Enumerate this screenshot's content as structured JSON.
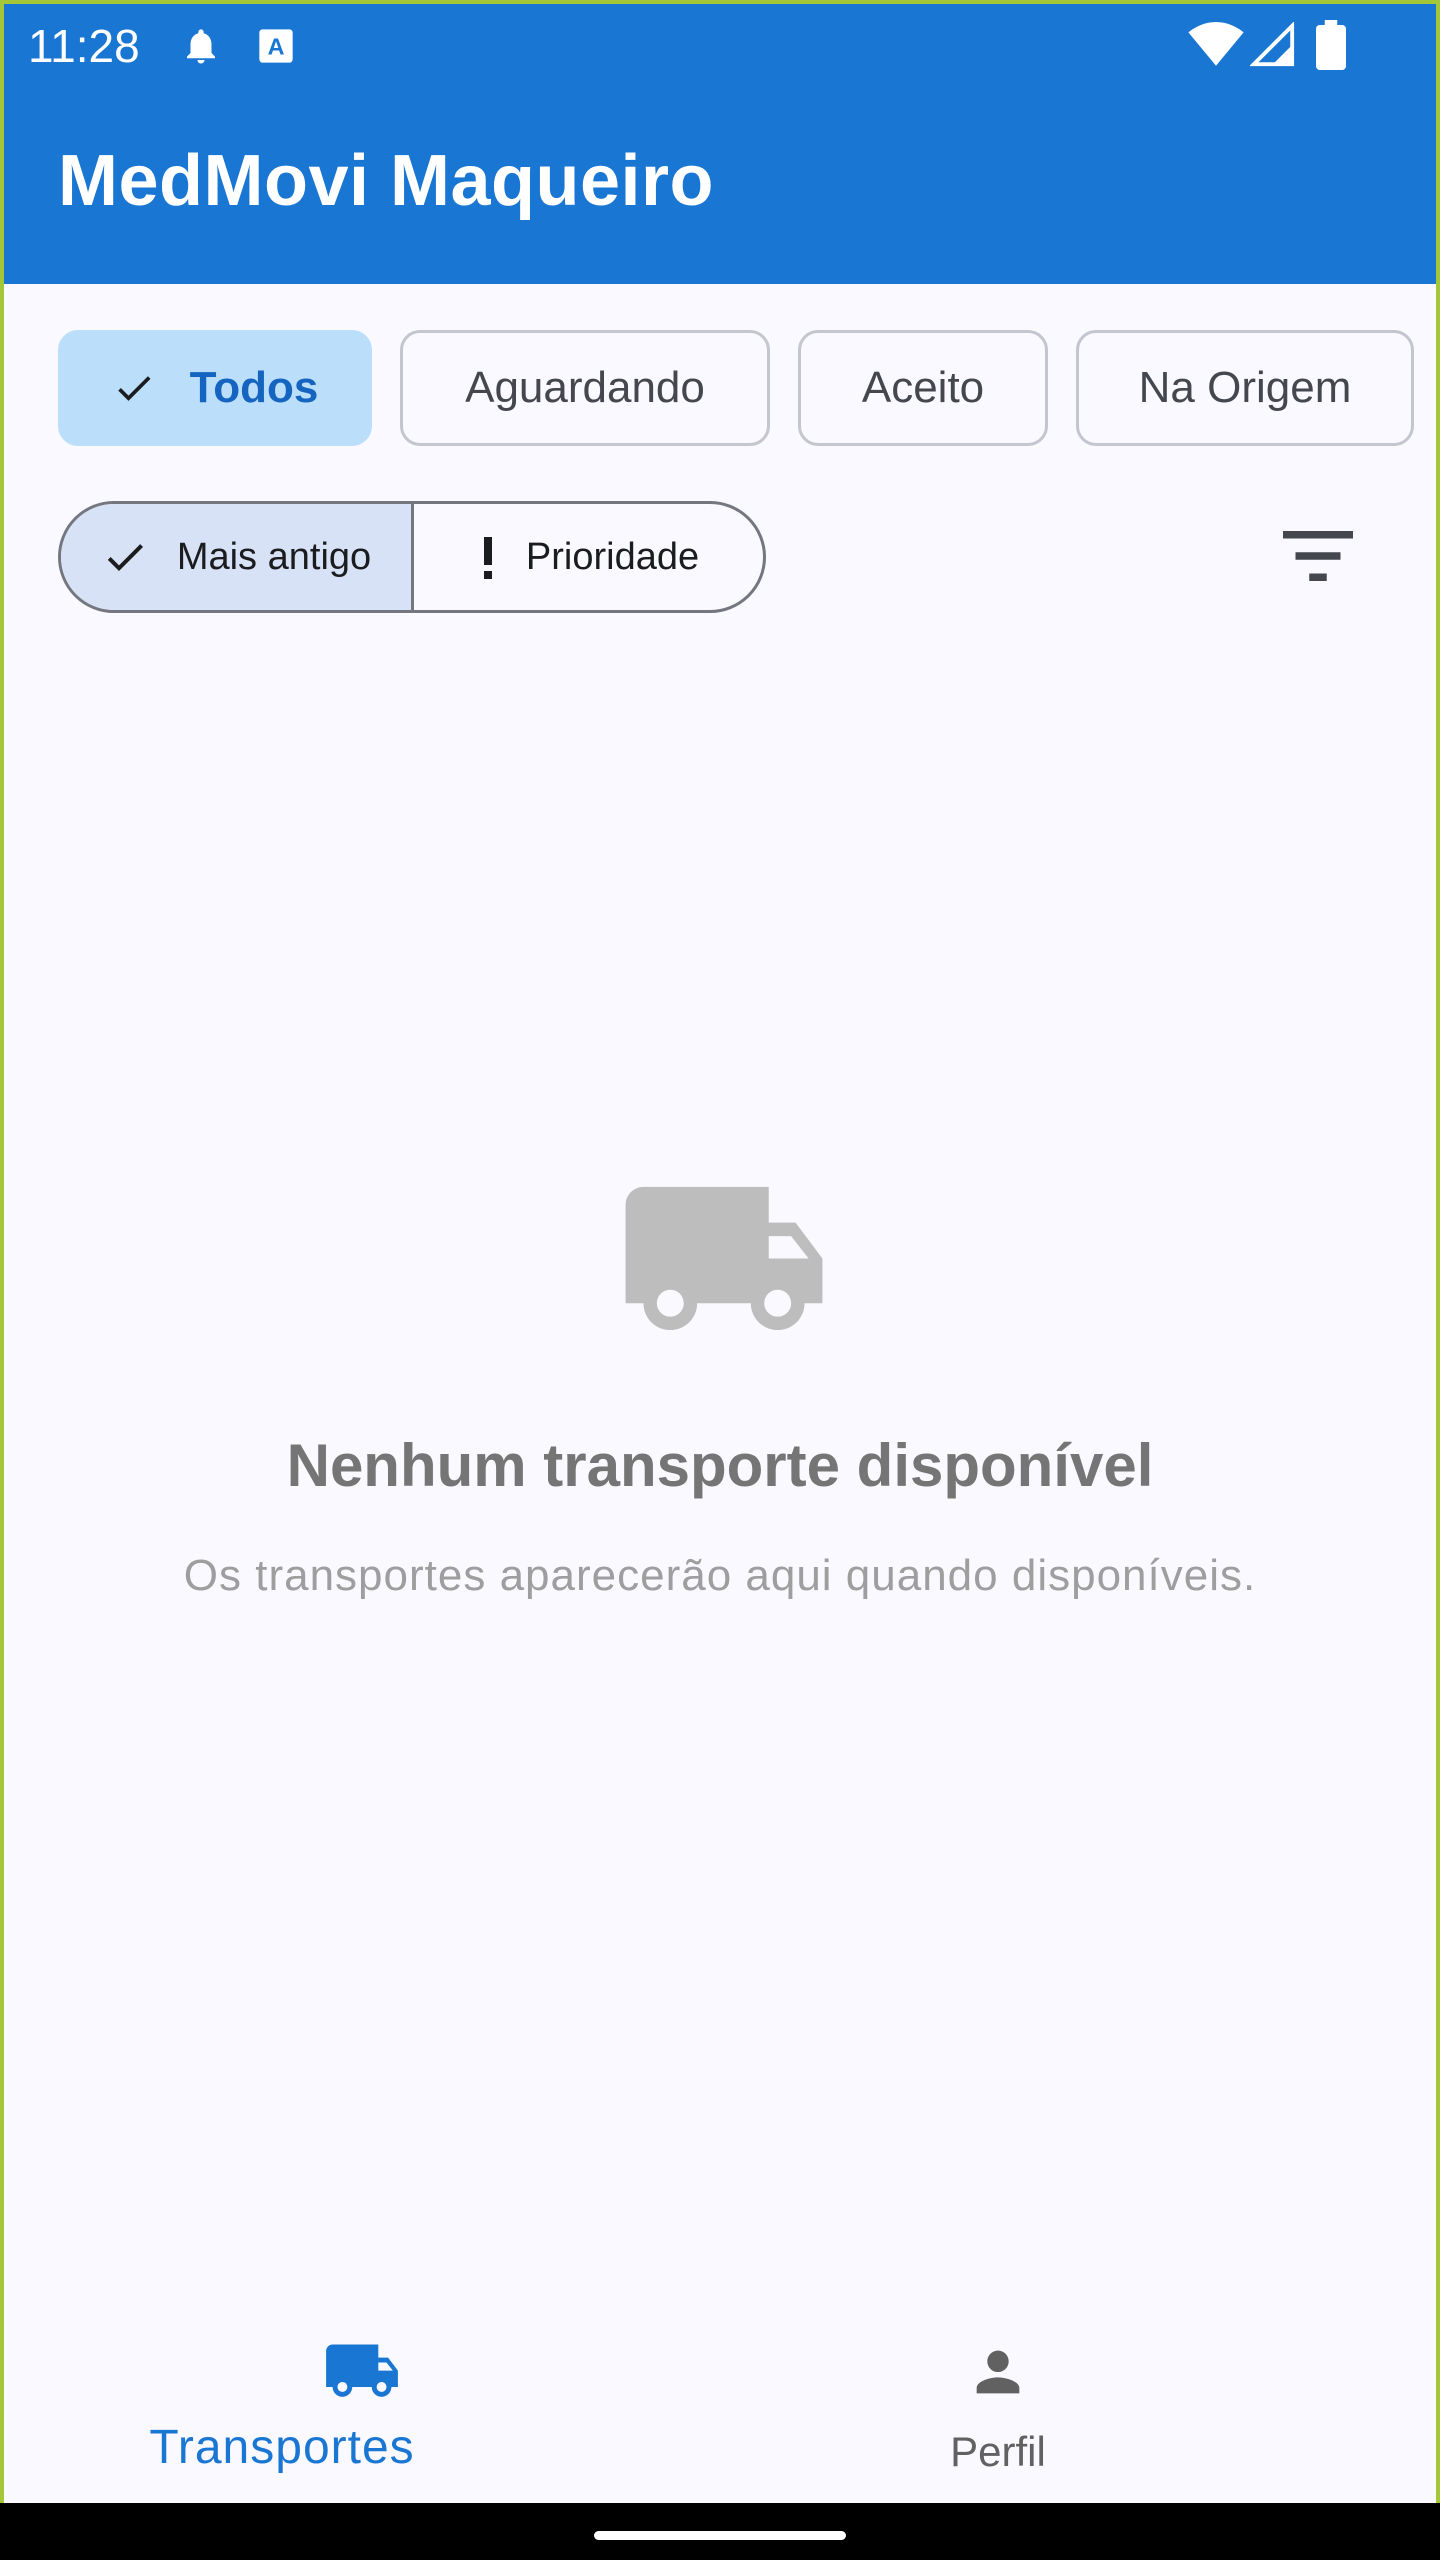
{
  "status_bar": {
    "time": "11:28",
    "left_icons": [
      "bell-icon",
      "a-notification-icon"
    ],
    "right_icons": [
      "wifi-icon",
      "signal-icon",
      "battery-icon"
    ]
  },
  "app_bar": {
    "title": "MedMovi Maqueiro",
    "color": "#1976d2"
  },
  "status_filters": [
    {
      "label": "Todos",
      "selected": true,
      "icon": "check-icon"
    },
    {
      "label": "Aguardando",
      "selected": false
    },
    {
      "label": "Aceito",
      "selected": false
    },
    {
      "label": "Na Origem",
      "selected": false
    }
  ],
  "sort_toggle": {
    "options": [
      {
        "label": "Mais antigo",
        "selected": true,
        "icon": "check-icon"
      },
      {
        "label": "Prioridade",
        "selected": false,
        "icon": "exclamation-icon"
      }
    ]
  },
  "filter_button": {
    "icon": "filter-list-icon"
  },
  "empty_state": {
    "icon": "truck-icon",
    "title": "Nenhum transporte disponível",
    "subtitle": "Os transportes aparecerão aqui quando disponíveis."
  },
  "bottom_nav": {
    "items": [
      {
        "label": "Transportes",
        "icon": "truck-icon",
        "active": true,
        "color": "#1976d2"
      },
      {
        "label": "Perfil",
        "icon": "person-icon",
        "active": false,
        "color": "#616161"
      }
    ]
  }
}
